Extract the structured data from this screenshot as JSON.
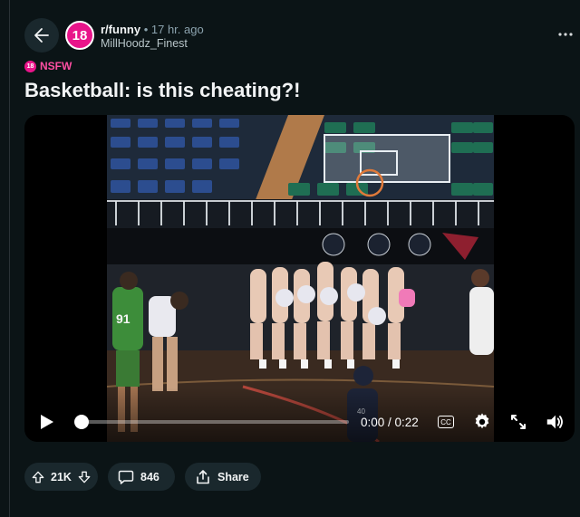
{
  "post": {
    "subreddit": "r/funny",
    "separator": "•",
    "time_ago": "17 hr. ago",
    "author": "MillHoodz_Finest",
    "subreddit_icon_text": "18",
    "nsfw_badge_text": "18",
    "nsfw_label": "NSFW",
    "title": "Basketball: is this cheating?!"
  },
  "video": {
    "time_display": "0:00 / 0:22",
    "cc_label": "CC",
    "progress": 0.0,
    "colors": {
      "court": "#3a2a20",
      "seats_blue": "#2c4d8f",
      "seats_green": "#1f6e53"
    }
  },
  "actions": {
    "votes": "21K",
    "comments": "846",
    "share_label": "Share"
  },
  "colors": {
    "background": "#0b1416",
    "pill": "#1a282d",
    "nsfw": "#ff4fa3",
    "brand": "#e9148a"
  },
  "icons": {
    "back": "back-arrow-icon",
    "more": "more-dots-icon",
    "play": "play-icon",
    "settings": "gear-icon",
    "fullscreen": "expand-icon",
    "volume": "volume-icon",
    "upvote": "upvote-arrow-icon",
    "downvote": "downvote-arrow-icon",
    "comment": "comment-bubble-icon",
    "share": "share-icon"
  }
}
